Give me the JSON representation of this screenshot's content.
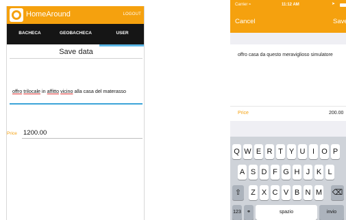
{
  "android": {
    "app_title": "HomeAround",
    "logout_label": "LOGOUT",
    "tabs": [
      {
        "label": "BACHECA"
      },
      {
        "label": "GEOBACHECA"
      },
      {
        "label": "USER"
      }
    ],
    "selected_tab": "USER",
    "heading": "Save data",
    "description_words": [
      "offro",
      "trilocale",
      "in",
      "affitto",
      "vicino",
      "alla casa del materasso"
    ],
    "price_label": "Price",
    "price_value": "1200.00",
    "colors": {
      "accent": "#f5a10e",
      "tab_bar": "#151515",
      "tab_indicator": "#5bb7e6"
    }
  },
  "ios": {
    "status": {
      "carrier": "Carrier ≈",
      "time": "11:12 AM"
    },
    "cancel_label": "Cancel",
    "save_label": "Save",
    "description": "offro casa da questo meraviglioso simulatore",
    "price_label": "Price",
    "price_value": "200.00",
    "keyboard": {
      "row1": [
        "Q",
        "W",
        "E",
        "R",
        "T",
        "Y",
        "U",
        "I",
        "O",
        "P"
      ],
      "row2": [
        "A",
        "S",
        "D",
        "F",
        "G",
        "H",
        "J",
        "K",
        "L"
      ],
      "row3": [
        "Z",
        "X",
        "C",
        "V",
        "B",
        "N",
        "M"
      ],
      "numbers_label": "123",
      "space_label": "spazio",
      "return_label": "invio"
    }
  }
}
